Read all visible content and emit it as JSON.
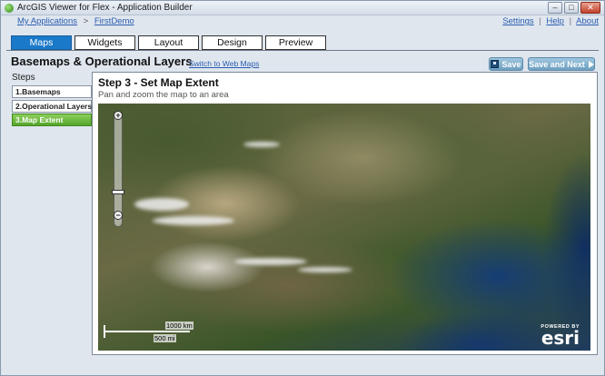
{
  "window": {
    "title": "ArcGIS Viewer for Flex - Application Builder",
    "buttons": {
      "minimize": "–",
      "maximize": "□",
      "close": "✕"
    }
  },
  "breadcrumb": {
    "root": "My Applications",
    "separator": ">",
    "current": "FirstDemo"
  },
  "toplinks": {
    "settings": "Settings",
    "help": "Help",
    "about": "About",
    "separator": "|"
  },
  "tabs": [
    {
      "label": "Maps",
      "active": true
    },
    {
      "label": "Widgets",
      "active": false
    },
    {
      "label": "Layout",
      "active": false
    },
    {
      "label": "Design",
      "active": false
    },
    {
      "label": "Preview",
      "active": false
    }
  ],
  "page": {
    "title": "Basemaps & Operational Layers",
    "switch_link": "Switch to Web Maps",
    "save_label": "Save",
    "save_next_label": "Save and Next"
  },
  "steps": {
    "title": "Steps",
    "items": [
      {
        "label": "1.Basemaps",
        "active": false
      },
      {
        "label": "2.Operational Layers",
        "active": false
      },
      {
        "label": "3.Map Extent",
        "active": true
      }
    ]
  },
  "content": {
    "heading": "Step 3 - Set Map Extent",
    "subheading": "Pan and zoom the map to an area"
  },
  "map": {
    "zoom_in": "+",
    "zoom_out": "−",
    "scale_km": "1000 km",
    "scale_mi": "500 mi",
    "powered_by": "POWERED BY",
    "brand": "esri"
  },
  "colors": {
    "active_tab": "#1a79c9",
    "active_step": "#55a52a",
    "button": "#6e9fc0",
    "link": "#2c5db0"
  }
}
